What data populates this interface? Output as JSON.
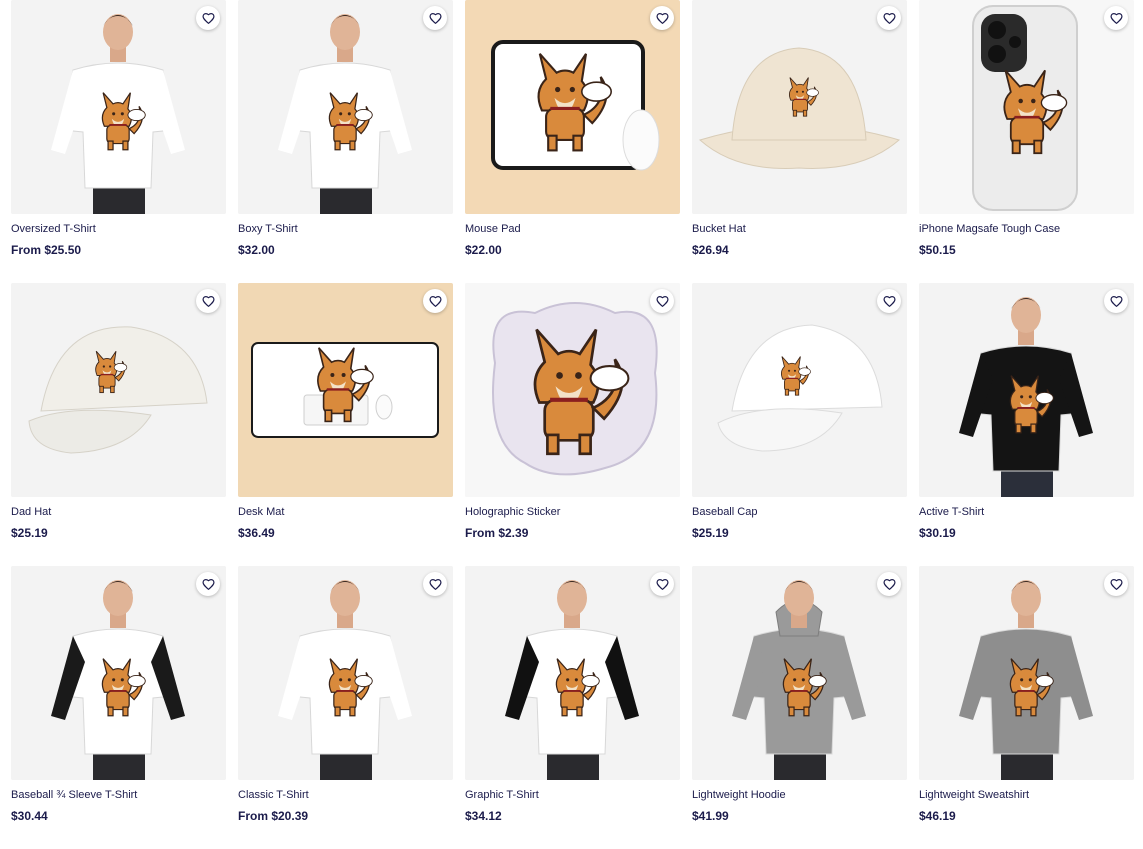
{
  "colors": {
    "text": "#1b1b4b",
    "thumb_bg": "#f2f2f2",
    "accent_dog": "#d98a3c"
  },
  "favorite_icon": "heart-outline-icon",
  "products": [
    {
      "name": "Oversized T-Shirt",
      "price": "From $25.50",
      "image": "model-white-tshirt"
    },
    {
      "name": "Boxy T-Shirt",
      "price": "$32.00",
      "image": "model-white-tshirt"
    },
    {
      "name": "Mouse Pad",
      "price": "$22.00",
      "image": "mouse-pad"
    },
    {
      "name": "Bucket Hat",
      "price": "$26.94",
      "image": "bucket-hat"
    },
    {
      "name": "iPhone Magsafe Tough Case",
      "price": "$50.15",
      "image": "phone-case"
    },
    {
      "name": "Dad Hat",
      "price": "$25.19",
      "image": "dad-hat"
    },
    {
      "name": "Desk Mat",
      "price": "$36.49",
      "image": "desk-mat"
    },
    {
      "name": "Holographic Sticker",
      "price": "From $2.39",
      "image": "sticker"
    },
    {
      "name": "Baseball Cap",
      "price": "$25.19",
      "image": "baseball-cap"
    },
    {
      "name": "Active T-Shirt",
      "price": "$30.19",
      "image": "model-black-tshirt"
    },
    {
      "name": "Baseball ¾ Sleeve T-Shirt",
      "price": "$30.44",
      "image": "model-raglan"
    },
    {
      "name": "Classic T-Shirt",
      "price": "From $20.39",
      "image": "model-white-tshirt"
    },
    {
      "name": "Graphic T-Shirt",
      "price": "$34.12",
      "image": "model-graphic-tshirt"
    },
    {
      "name": "Lightweight Hoodie",
      "price": "$41.99",
      "image": "model-hoodie"
    },
    {
      "name": "Lightweight Sweatshirt",
      "price": "$46.19",
      "image": "model-sweatshirt"
    }
  ]
}
